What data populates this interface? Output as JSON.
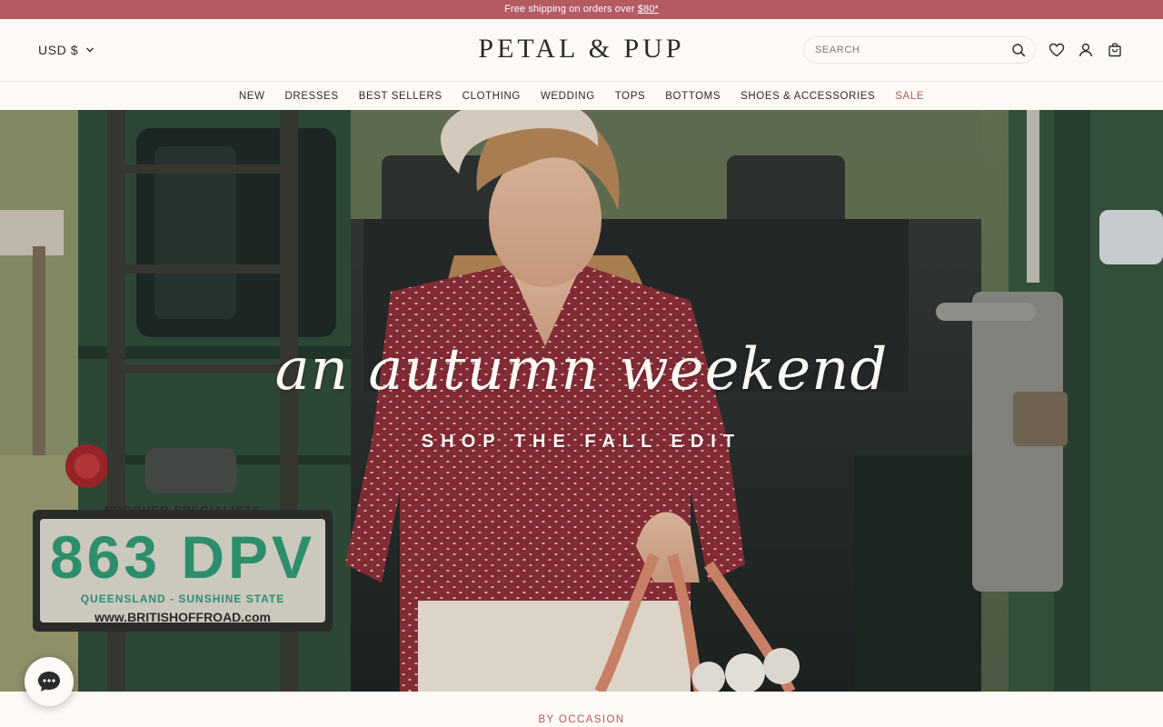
{
  "announcement": {
    "text": "Free shipping on orders over ",
    "amount": "$80*"
  },
  "header": {
    "currency": "USD $",
    "logo": "PETAL & PUP",
    "search_placeholder": "SEARCH",
    "icons": [
      "search-icon",
      "heart-icon",
      "user-icon",
      "bag-icon"
    ]
  },
  "nav": {
    "items": [
      "NEW",
      "DRESSES",
      "BEST SELLERS",
      "CLOTHING",
      "WEDDING",
      "TOPS",
      "BOTTOMS",
      "SHOES & ACCESSORIES",
      "SALE"
    ]
  },
  "hero": {
    "script_title": "an autumn weekend",
    "cta": "SHOP THE FALL EDIT",
    "plate_top": "NDROVER SPECIALISTS",
    "plate_number": "863 DPV",
    "plate_state": "QUEENSLAND - SUNSHINE STATE",
    "plate_url": "www.BRITISHOFFROAD.com"
  },
  "chat": {
    "icon": "chat-bubble-icon"
  },
  "section": {
    "label": "BY OCCASION"
  },
  "colors": {
    "accent": "#b45a62",
    "background": "#fdf9f5",
    "text": "#2b2b2b"
  }
}
